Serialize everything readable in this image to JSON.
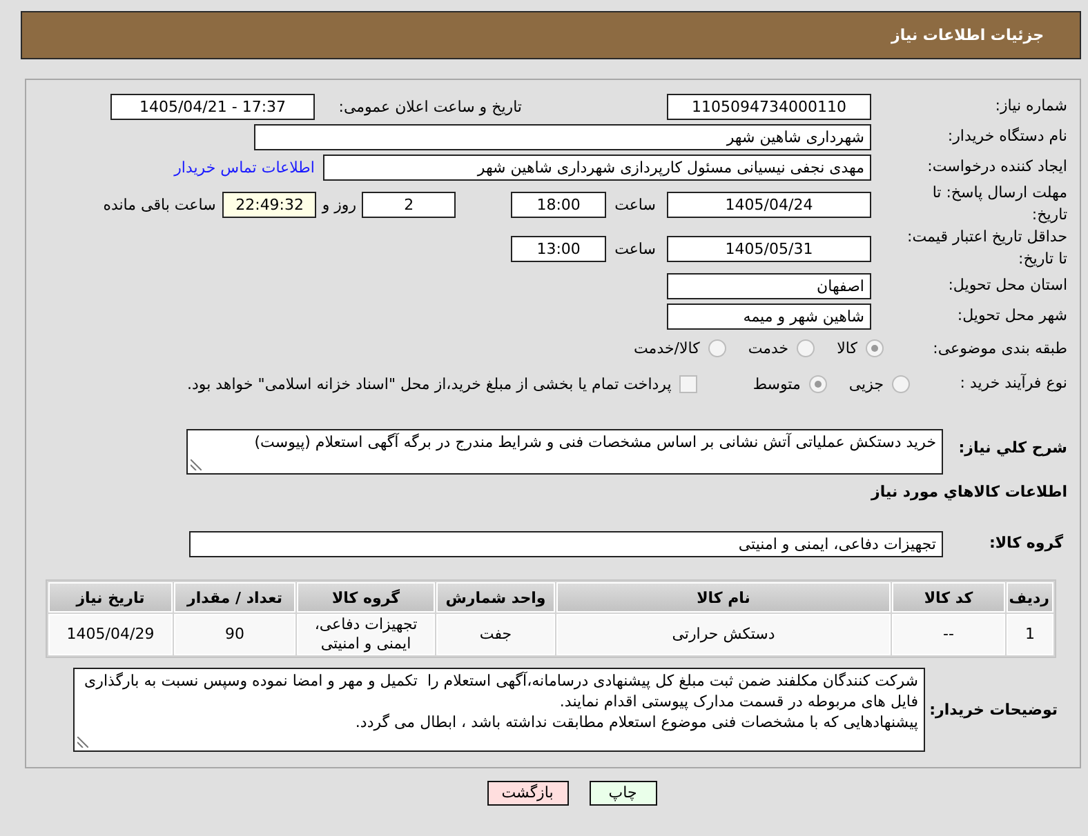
{
  "header": {
    "title": "جزئیات اطلاعات نیاز"
  },
  "details": {
    "need_number": {
      "label": "شماره نیاز:",
      "value": "1105094734000110"
    },
    "announcement": {
      "label": "تاریخ و ساعت اعلان عمومی:",
      "value": "1405/04/21 - 17:37"
    },
    "buyer_organization": {
      "label": "نام دستگاه خریدار:",
      "value": "شهرداری شاهین شهر"
    },
    "requester": {
      "label": "ایجاد کننده درخواست:",
      "value": "مهدی نجفی نیسیانی مسئول کارپردازی شهرداری شاهین شهر",
      "link": "اطلاعات تماس خریدار"
    },
    "response_deadline": {
      "label": "مهلت ارسال پاسخ: تا تاریخ:",
      "date": "1405/04/24",
      "time_label": "ساعت",
      "time": "18:00",
      "days": "2",
      "days_label": "روز و",
      "remaining": "22:49:32",
      "remaining_label": "ساعت باقی مانده"
    },
    "price_validity": {
      "label": "حداقل تاریخ اعتبار قیمت: تا تاریخ:",
      "date": "1405/05/31",
      "time_label": "ساعت",
      "time": "13:00"
    },
    "delivery_province": {
      "label": "استان محل تحویل:",
      "value": "اصفهان"
    },
    "delivery_city": {
      "label": "شهر محل تحویل:",
      "value": "شاهین شهر و میمه"
    },
    "subject_category": {
      "label": "طبقه بندی موضوعی:",
      "options": [
        {
          "label": "کالا",
          "selected": true
        },
        {
          "label": "خدمت",
          "selected": false
        },
        {
          "label": "کالا/خدمت",
          "selected": false
        }
      ]
    },
    "purchase_process": {
      "label": "نوع فرآیند خرید :",
      "options": [
        {
          "label": "جزیی",
          "selected": false
        },
        {
          "label": "متوسط",
          "selected": true
        }
      ],
      "treasury_payment": {
        "label": "پرداخت تمام یا بخشی از مبلغ خرید،از محل \"اسناد خزانه اسلامی\" خواهد بود.",
        "checked": false
      }
    },
    "description": {
      "label": "شرح کلي نياز:",
      "value": "خرید دستکش عملیاتی آتش نشانی بر اساس مشخصات فنی و شرایط مندرج در برگه آگهی استعلام (پیوست)"
    }
  },
  "goods": {
    "title": "اطلاعات کالاهاي مورد نياز",
    "group": {
      "label": "گروه کالا:",
      "value": "تجهیزات دفاعی، ایمنی و امنیتی"
    },
    "table": {
      "columns": [
        "ردیف",
        "کد کالا",
        "نام کالا",
        "واحد شمارش",
        "گروه کالا",
        "تعداد / مقدار",
        "تاریخ نیاز"
      ],
      "rows": [
        [
          "1",
          "--",
          "دستکش حرارتی",
          "جفت",
          "تجهیزات دفاعی، ایمنی و امنیتی",
          "90",
          "1405/04/29"
        ]
      ]
    }
  },
  "buyer_notes": {
    "label": "توضیحات خریدار:",
    "value": "شرکت کنندگان مکلفند ضمن ثبت مبلغ کل پیشنهادی درسامانه،آگهی استعلام را  تکمیل و مهر و امضا نموده وسپس نسبت به بارگذاری فایل های مربوطه در قسمت مدارک پیوستی اقدام نمایند.\nپیشنهادهایی که با مشخصات فنی موضوع استعلام مطابقت نداشته باشد ، ابطال می گردد."
  },
  "buttons": [
    {
      "label": "چاپ",
      "kind": "print"
    },
    {
      "label": "بازگشت",
      "kind": "back"
    }
  ]
}
